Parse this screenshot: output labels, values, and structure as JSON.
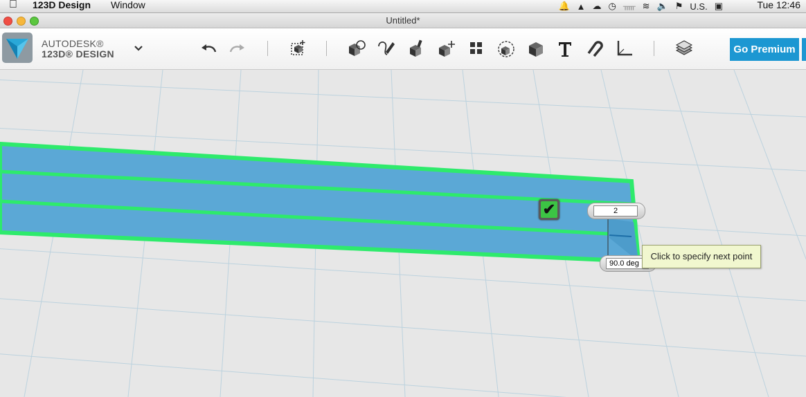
{
  "menubar": {
    "app_name": "123D Design",
    "menus": [
      "Window"
    ],
    "input_source": "U.S.",
    "clock": "Tue 12:46"
  },
  "window": {
    "title": "Untitled*"
  },
  "toolbar": {
    "brand_line1": "AUTODESK®",
    "brand_line2": "123D® DESIGN",
    "premium_label": "Go Premium",
    "tools": [
      "undo",
      "redo",
      "transform",
      "primitives",
      "sketch",
      "construct",
      "modify",
      "pattern",
      "grouping",
      "combine",
      "measure",
      "text",
      "snap",
      "ruler",
      "materials"
    ]
  },
  "viewport": {
    "length_value": "2",
    "angle_value": "90.0 deg",
    "tooltip": "Click to specify next point",
    "colors": {
      "grid_bg": "#e7e7e7",
      "solid_fill": "#5ba8d6",
      "highlight": "#2eea6c"
    }
  }
}
